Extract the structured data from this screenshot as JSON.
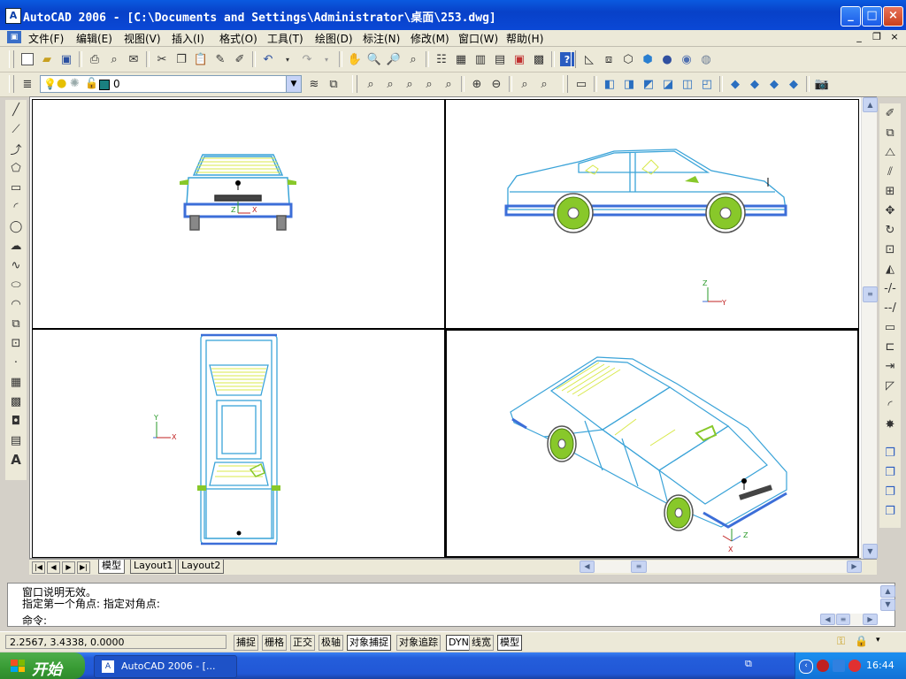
{
  "window": {
    "title": "AutoCAD 2006 - [C:\\Documents and Settings\\Administrator\\桌面\\253.dwg]",
    "minimize": "_",
    "maximize": "□",
    "close": "×"
  },
  "menu": {
    "items": [
      "文件(F)",
      "编辑(E)",
      "视图(V)",
      "插入(I)",
      "格式(O)",
      "工具(T)",
      "绘图(D)",
      "标注(N)",
      "修改(M)",
      "窗口(W)",
      "帮助(H)"
    ],
    "doc_minimize": "_",
    "doc_restore": "❐",
    "doc_close": "×"
  },
  "layer_toolbar": {
    "current_layer": "0"
  },
  "tabs": {
    "items": [
      "模型",
      "Layout1",
      "Layout2"
    ],
    "active": "模型"
  },
  "command": {
    "lines": [
      "窗口说明无效。",
      "指定第一个角点: 指定对角点:"
    ],
    "prompt": "命令:"
  },
  "status": {
    "coordinates": "2.2567,   3.4338,  0.0000",
    "toggles": [
      {
        "label": "捕捉",
        "on": false
      },
      {
        "label": "栅格",
        "on": false
      },
      {
        "label": "正交",
        "on": false
      },
      {
        "label": "极轴",
        "on": false
      },
      {
        "label": "对象捕捉",
        "on": true
      },
      {
        "label": "对象追踪",
        "on": false
      },
      {
        "label": "DYN",
        "on": true
      },
      {
        "label": "线宽",
        "on": false
      },
      {
        "label": "模型",
        "on": true
      }
    ]
  },
  "taskbar": {
    "start": "开始",
    "task_item": "AutoCAD 2006 - [...",
    "clock": "16:44"
  },
  "colors": {
    "cyan_lines": "#3aa3d8",
    "blue_lines": "#3c6ed8",
    "green_wheel": "#88c82a",
    "yellow_interior": "#d8e84a",
    "title_blue": "#0a48d6",
    "taskbar_blue": "#245edb"
  }
}
